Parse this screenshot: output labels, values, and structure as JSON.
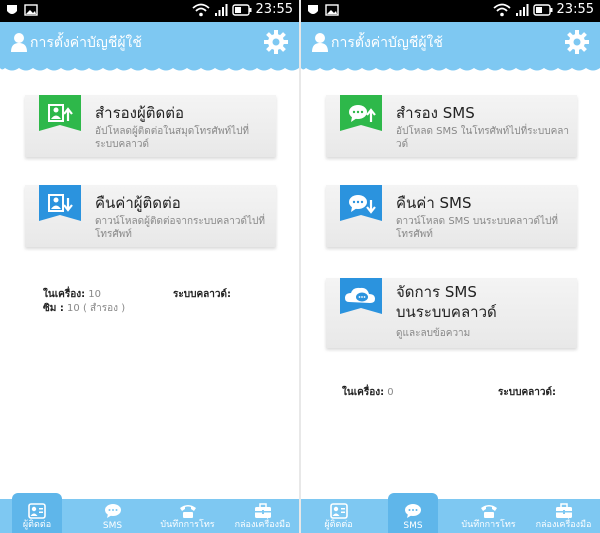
{
  "status_bar": {
    "time": "23:55"
  },
  "left_screen": {
    "header_title": "การตั้งค่าบัญชีผู้ใช้",
    "cards": [
      {
        "title": "สำรองผู้ติดต่อ",
        "subtitle": "อัปโหลดผู้ติดต่อในสมุดโทรศัพท์ไปที่ระบบคลาวด์",
        "icon": "contact-upload-icon",
        "color": "#2eb84a"
      },
      {
        "title": "คืนค่าผู้ติดต่อ",
        "subtitle": "ดาวน์โหลดผู้ติดต่อจากระบบคลาวด์ไปที่โทรศัพท์",
        "icon": "contact-download-icon",
        "color": "#2b93de"
      }
    ],
    "info": {
      "device_label": "ในเครื่อง:",
      "device_value": "10",
      "sim_label": "ซิม :",
      "sim_value": "10 ( สำรอง )",
      "cloud_label": "ระบบคลาวด์:"
    },
    "active_tab": 0
  },
  "right_screen": {
    "header_title": "การตั้งค่าบัญชีผู้ใช้",
    "cards": [
      {
        "title": "สำรอง SMS",
        "subtitle": "อัปโหลด SMS ในโทรศัพท์ไปที่ระบบคลาวด์",
        "icon": "sms-upload-icon",
        "color": "#2eb84a"
      },
      {
        "title": "คืนค่า SMS",
        "subtitle": "ดาวน์โหลด SMS บนระบบคลาวด์ไปที่โทรศัพท์",
        "icon": "sms-download-icon",
        "color": "#2b93de"
      },
      {
        "title": "จัดการ SMS บนระบบคลาวด์",
        "title_line1": "จัดการ SMS",
        "title_line2": "บนระบบคลาวด์",
        "subtitle": "ดูและลบข้อความ",
        "icon": "cloud-sms-icon",
        "color": "#2b93de"
      }
    ],
    "info": {
      "device_label": "ในเครื่อง:",
      "device_value": "0",
      "cloud_label": "ระบบคลาวด์:"
    },
    "active_tab": 1
  },
  "nav": {
    "tabs": [
      {
        "label": "ผู้ติดต่อ",
        "icon": "contacts-icon"
      },
      {
        "label": "SMS",
        "icon": "sms-icon"
      },
      {
        "label": "บันทึกการโทร",
        "icon": "phone-icon"
      },
      {
        "label": "กล่องเครื่องมือ",
        "icon": "toolbox-icon"
      }
    ]
  },
  "colors": {
    "header": "#7ec8f2",
    "green": "#2eb84a",
    "blue": "#2b93de"
  }
}
